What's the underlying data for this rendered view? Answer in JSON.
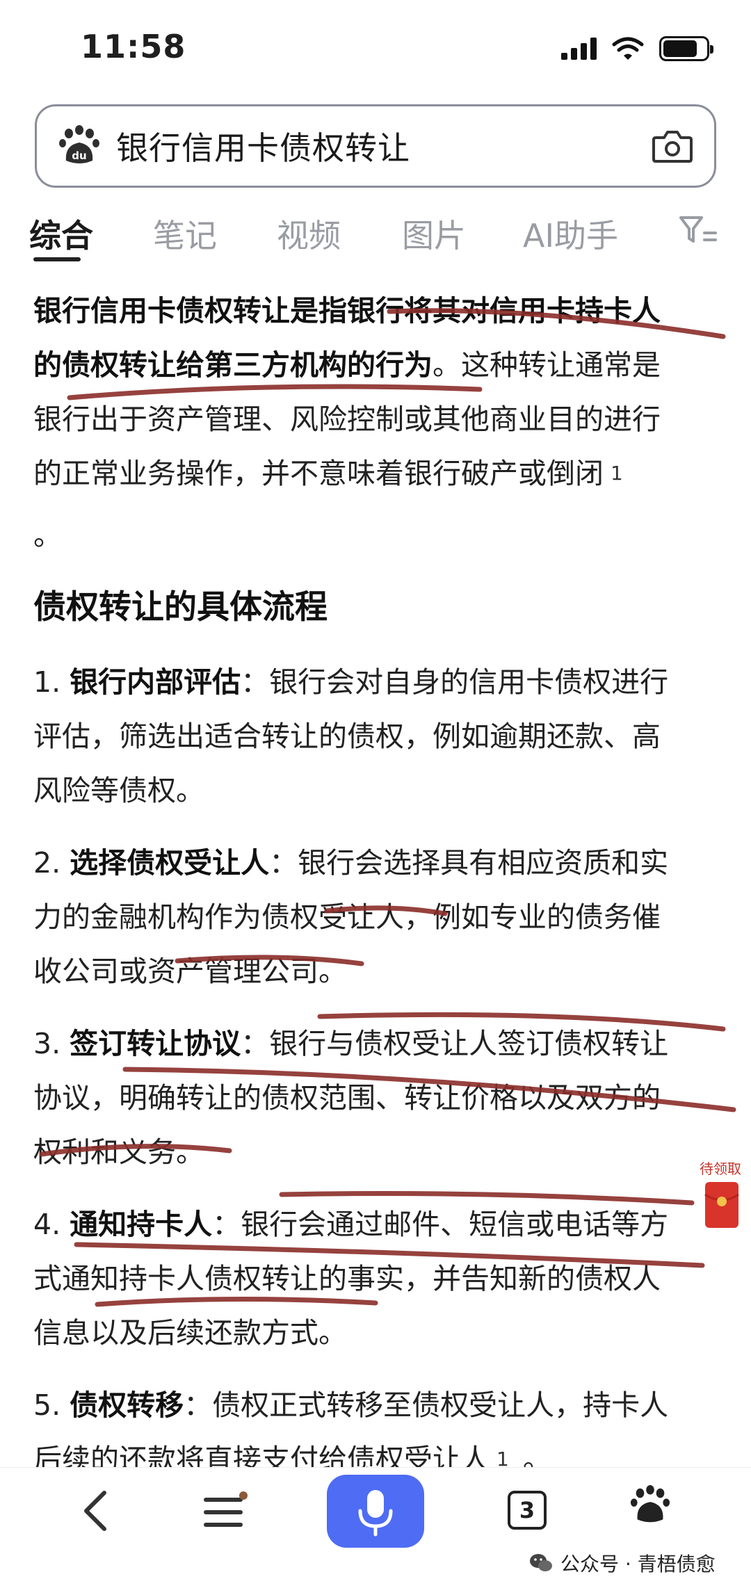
{
  "status_bar": {
    "time": "11:58"
  },
  "search": {
    "query": "银行信用卡债权转让"
  },
  "tabs": [
    {
      "label": "综合",
      "active": true
    },
    {
      "label": "笔记",
      "active": false
    },
    {
      "label": "视频",
      "active": false
    },
    {
      "label": "图片",
      "active": false
    },
    {
      "label": "AI助手",
      "active": false
    }
  ],
  "content": {
    "intro": {
      "line1": "银行信用卡债权转让是指银行将其对信用卡持卡人",
      "line2_bold": "的债权转让给第三方机构的行为",
      "line2_rest": "。这种转让通常是",
      "line3": "银行出于资产管理、风险控制或其他商业目的进行",
      "line4": "的正常业务操作，并不意味着银行破产或倒闭",
      "cite": "1",
      "period": "。"
    },
    "section_title": "债权转让的具体流程",
    "steps": [
      {
        "num": "1.",
        "title": "银行内部评估",
        "lines": [
          "：银行会对自身的信用卡债权进行",
          "评估，筛选出适合转让的债权，例如逾期还款、高",
          "风险等债权。"
        ]
      },
      {
        "num": "2.",
        "title": "选择债权受让人",
        "lines": [
          "：银行会选择具有相应资质和实",
          "力的金融机构作为债权受让人，例如专业的债务催",
          "收公司或资产管理公司。"
        ]
      },
      {
        "num": "3.",
        "title": "签订转让协议",
        "lines": [
          "：银行与债权受让人签订债权转让",
          "协议，明确转让的债权范围、转让价格以及双方的",
          "权利和义务。"
        ]
      },
      {
        "num": "4.",
        "title": "通知持卡人",
        "lines": [
          "：银行会通过邮件、短信或电话等方",
          "式通知持卡人债权转让的事实，并告知新的债权人",
          "信息以及后续还款方式。"
        ]
      },
      {
        "num": "5.",
        "title": "债权转移",
        "lines": [
          "：债权正式转移至债权受让人，持卡人",
          "后续的还款将直接支付给债权受让人"
        ],
        "cite": "1",
        "tail": "。"
      }
    ]
  },
  "red_envelope": {
    "label": "待领取"
  },
  "bottom_nav": {
    "tab_count": "3"
  },
  "watermark": {
    "text": "公众号 · 青梧债愈"
  },
  "colors": {
    "accent_blue": "#4e6cf4",
    "marker_red": "#8b2e2a",
    "envelope_red": "#d8342b"
  }
}
